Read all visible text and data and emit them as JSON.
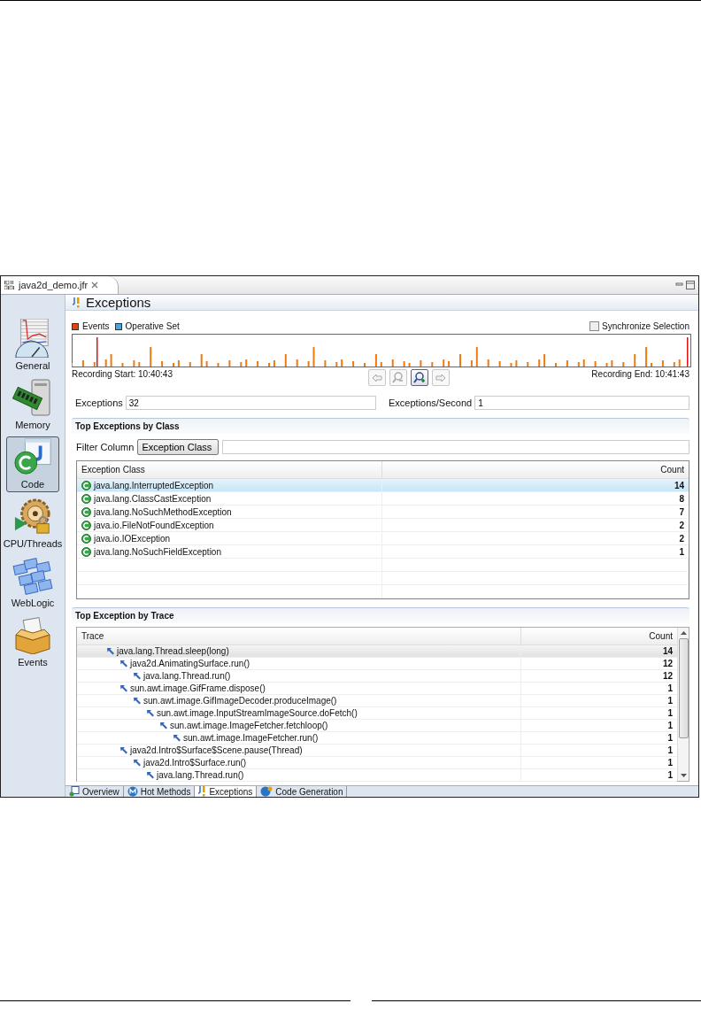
{
  "editor_tab": {
    "title": "java2d_demo.jfr"
  },
  "sidebar": {
    "items": [
      {
        "label": "General",
        "kind": "general",
        "selected": false
      },
      {
        "label": "Memory",
        "kind": "memory",
        "selected": false
      },
      {
        "label": "Code",
        "kind": "code",
        "selected": true
      },
      {
        "label": "CPU/Threads",
        "kind": "cpu",
        "selected": false
      },
      {
        "label": "WebLogic",
        "kind": "weblogic",
        "selected": false
      },
      {
        "label": "Events",
        "kind": "events",
        "selected": false
      }
    ]
  },
  "page": {
    "title": "Exceptions"
  },
  "timeline": {
    "legend": [
      {
        "label": "Events",
        "color": "#e8420c"
      },
      {
        "label": "Operative Set",
        "color": "#3fa9e0"
      }
    ],
    "sync": {
      "label": "Synchronize Selection",
      "checked": false
    },
    "start": "Recording Start: 10:40:43",
    "end": "Recording End: 10:41:43",
    "nav_buttons": [
      {
        "kind": "back",
        "disabled": true
      },
      {
        "kind": "zoom-out",
        "disabled": true
      },
      {
        "kind": "zoom-in",
        "disabled": false
      },
      {
        "kind": "forward",
        "disabled": true
      }
    ]
  },
  "fields": [
    {
      "label": "Exceptions",
      "value": "32"
    },
    {
      "label": "Exceptions/Second",
      "value": "1"
    }
  ],
  "class_section": {
    "title": "Top Exceptions by Class",
    "filter_label": "Filter Column",
    "filter_value": "Exception Class",
    "columns": [
      "Exception Class",
      "Count"
    ],
    "rows": [
      {
        "name": "java.lang.InterruptedException",
        "count": "14",
        "selected": true
      },
      {
        "name": "java.lang.ClassCastException",
        "count": "8",
        "selected": false
      },
      {
        "name": "java.lang.NoSuchMethodException",
        "count": "7",
        "selected": false
      },
      {
        "name": "java.io.FileNotFoundException",
        "count": "2",
        "selected": false
      },
      {
        "name": "java.io.IOException",
        "count": "2",
        "selected": false
      },
      {
        "name": "java.lang.NoSuchFieldException",
        "count": "1",
        "selected": false
      }
    ]
  },
  "trace_section": {
    "title": "Top Exception by Trace",
    "columns": [
      "Trace",
      "Count"
    ],
    "rows": [
      {
        "frame": "java.lang.Thread.sleep(long)",
        "count": "14",
        "selected": true,
        "children": [
          {
            "frame": "java2d.AnimatingSurface.run()",
            "count": "12",
            "selected": false,
            "children": [
              {
                "frame": "java.lang.Thread.run()",
                "count": "12",
                "selected": false
              }
            ]
          },
          {
            "frame": "sun.awt.image.GifFrame.dispose()",
            "count": "1",
            "selected": false,
            "children": [
              {
                "frame": "sun.awt.image.GifImageDecoder.produceImage()",
                "count": "1",
                "selected": false,
                "children": [
                  {
                    "frame": "sun.awt.image.InputStreamImageSource.doFetch()",
                    "count": "1",
                    "selected": false,
                    "children": [
                      {
                        "frame": "sun.awt.image.ImageFetcher.fetchloop()",
                        "count": "1",
                        "selected": false,
                        "children": [
                          {
                            "frame": "sun.awt.image.ImageFetcher.run()",
                            "count": "1",
                            "selected": false
                          }
                        ]
                      }
                    ]
                  }
                ]
              }
            ]
          },
          {
            "frame": "java2d.Intro$Surface$Scene.pause(Thread)",
            "count": "1",
            "selected": false,
            "children": [
              {
                "frame": "java2d.Intro$Surface.run()",
                "count": "1",
                "selected": false,
                "children": [
                  {
                    "frame": "java.lang.Thread.run()",
                    "count": "1",
                    "selected": false
                  }
                ]
              }
            ]
          }
        ]
      }
    ]
  },
  "bottom_tabs": [
    {
      "label": "Overview",
      "kind": "overview",
      "selected": false
    },
    {
      "label": "Hot Methods",
      "kind": "hot",
      "selected": false
    },
    {
      "label": "Exceptions",
      "kind": "exceptions",
      "selected": true
    },
    {
      "label": "Code Generation",
      "kind": "codegen",
      "selected": false
    }
  ]
}
